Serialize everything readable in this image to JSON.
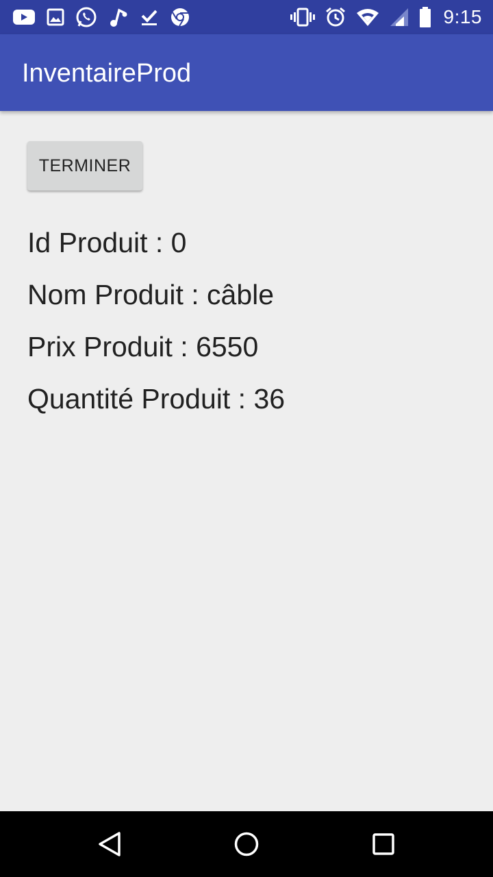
{
  "status_bar": {
    "time": "9:15",
    "left_icons": [
      "youtube-icon",
      "image-icon",
      "whatsapp-icon",
      "music-icon",
      "download-done-icon",
      "chrome-icon"
    ],
    "right_icons": [
      "vibrate-icon",
      "alarm-icon",
      "wifi-icon",
      "signal-icon",
      "battery-icon"
    ],
    "bar_color": "#303f9f"
  },
  "app_bar": {
    "title": "InventaireProd",
    "color": "#3f51b5"
  },
  "main": {
    "finish_button_label": "TERMINER",
    "fields": [
      {
        "label": "Id Produit",
        "value": "0",
        "text": "Id Produit : 0"
      },
      {
        "label": "Nom Produit",
        "value": "câble",
        "text": "Nom Produit : câble"
      },
      {
        "label": "Prix Produit",
        "value": "6550",
        "text": "Prix Produit : 6550"
      },
      {
        "label": "Quantité Produit",
        "value": "36",
        "text": "Quantité Produit : 36"
      }
    ]
  },
  "nav_bar": {
    "buttons": [
      "back-icon",
      "home-icon",
      "recents-icon"
    ]
  }
}
